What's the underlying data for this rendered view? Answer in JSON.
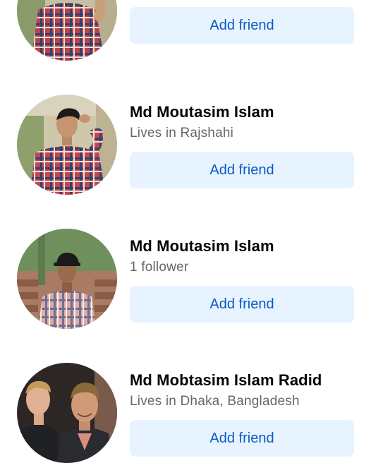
{
  "results": [
    {
      "name": "",
      "subtitle": "",
      "button_label": "Add friend",
      "avatar_icon": "person-plaid-shirt-photo"
    },
    {
      "name": "Md Moutasim Islam",
      "subtitle": "Lives in Rajshahi",
      "button_label": "Add friend",
      "avatar_icon": "person-plaid-shirt-photo"
    },
    {
      "name": "Md Moutasim Islam",
      "subtitle": "1 follower",
      "button_label": "Add friend",
      "avatar_icon": "person-cap-plaid-shirt-photo"
    },
    {
      "name": "Md Mobtasim Islam Radid",
      "subtitle": "Lives in Dhaka, Bangladesh",
      "button_label": "Add friend",
      "avatar_icon": "two-men-photo"
    }
  ],
  "colors": {
    "button_bg": "#e7f3ff",
    "button_text": "#0a5bc4",
    "name_text": "#050505",
    "subtitle_text": "#65676b"
  }
}
